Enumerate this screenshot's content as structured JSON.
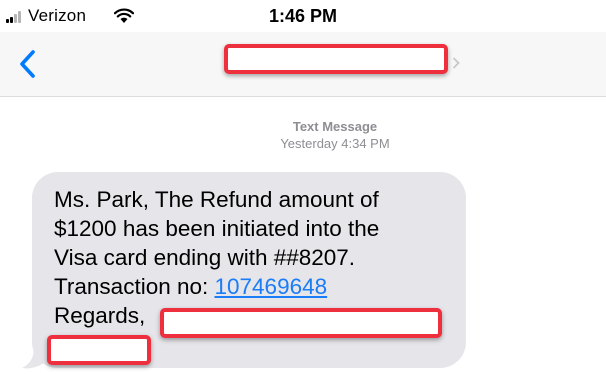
{
  "status_bar": {
    "carrier": "Verizon",
    "time": "1:46 PM"
  },
  "nav": {
    "back_icon": "chevron-left-icon",
    "contact_name_redacted": true
  },
  "thread": {
    "kind": "Text Message",
    "timestamp": "Yesterday 4:34 PM"
  },
  "message": {
    "line1": "Ms. Park, The Refund amount of",
    "line2": "$1200 has been initiated into the",
    "line3": "Visa card ending with ##8207.",
    "line4_prefix": "Transaction no: ",
    "transaction_no": "107469648",
    "line5": "Regards,",
    "sender_redacted": true
  },
  "colors": {
    "bubble": "#e5e5ea",
    "link": "#1a7cf7",
    "ios_blue": "#007aff",
    "redaction_border": "#ee2f3e",
    "meta_text": "#8e8e93",
    "nav_bg": "#f7f7f7"
  }
}
